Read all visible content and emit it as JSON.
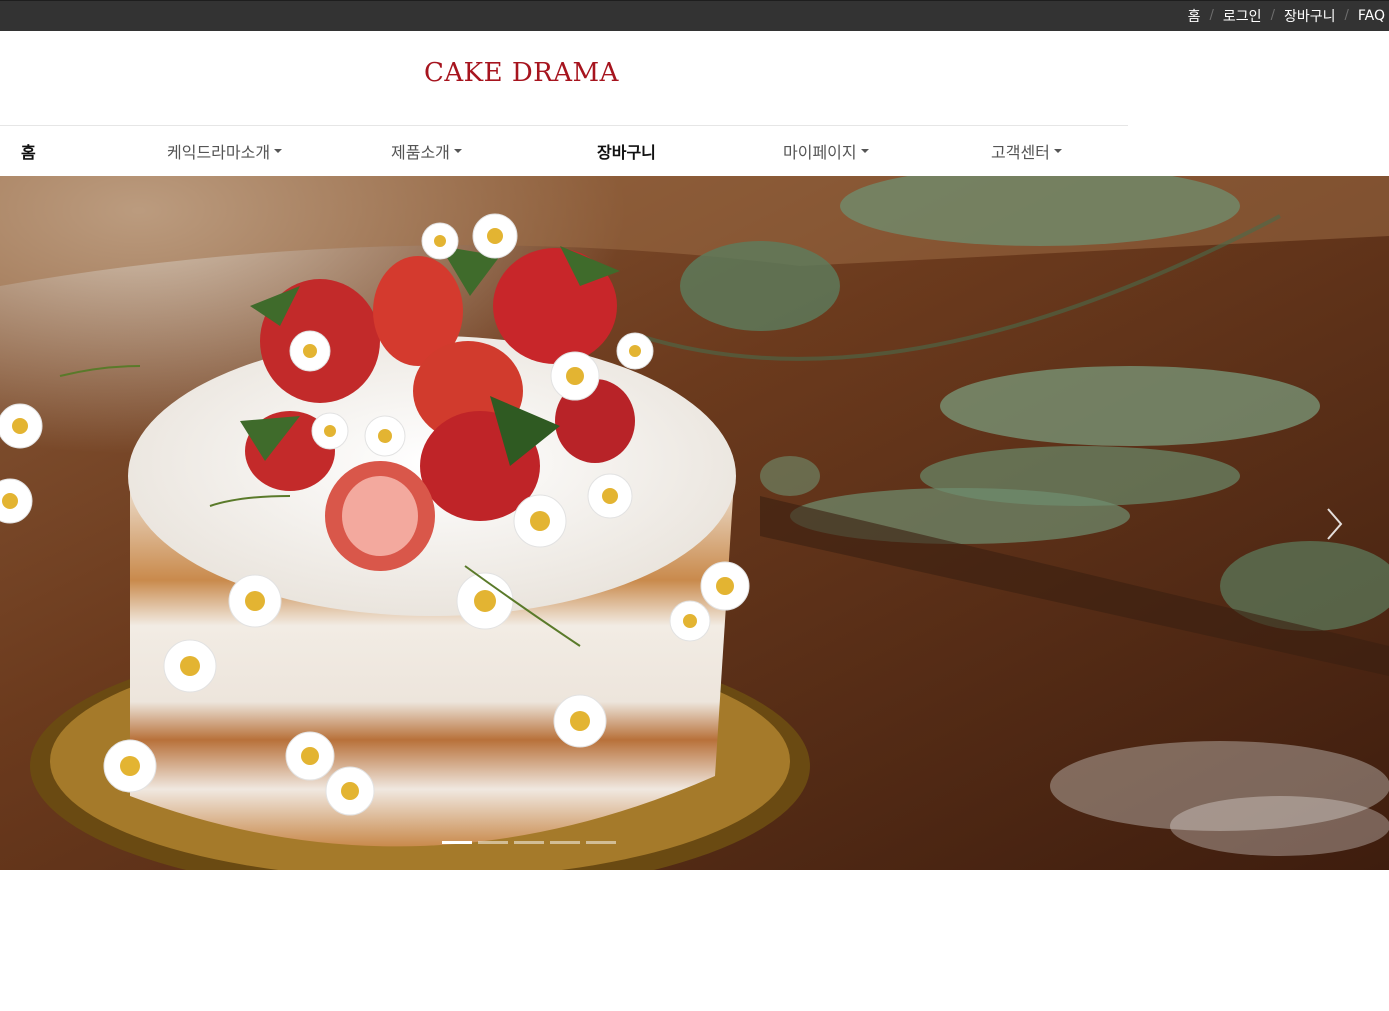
{
  "topbar": {
    "links": [
      "홈",
      "로그인",
      "장바구니",
      "FAQ"
    ],
    "separator": "/"
  },
  "header": {
    "logo": "CAKE DRAMA"
  },
  "nav": {
    "items": [
      {
        "label": "홈",
        "dropdown": false,
        "strong": true
      },
      {
        "label": "케익드라마소개",
        "dropdown": true,
        "strong": false
      },
      {
        "label": "제품소개",
        "dropdown": true,
        "strong": false
      },
      {
        "label": "장바구니",
        "dropdown": false,
        "strong": true
      },
      {
        "label": "마이페이지",
        "dropdown": true,
        "strong": false
      },
      {
        "label": "고객센터",
        "dropdown": true,
        "strong": false
      }
    ]
  },
  "carousel": {
    "slide_count": 5,
    "active_index": 0,
    "next_icon": "chevron-right-icon"
  },
  "colors": {
    "topbar": "#333333",
    "logo": "#a6141e",
    "nav_text": "#555555",
    "nav_strong": "#111111"
  }
}
